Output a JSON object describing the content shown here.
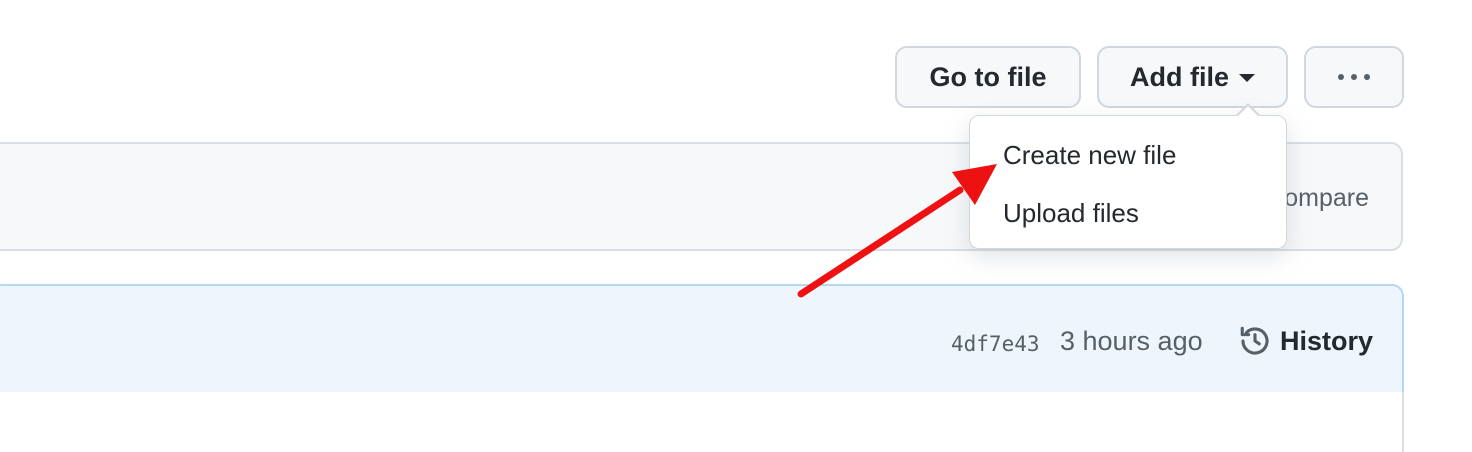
{
  "toolbar": {
    "go_to_file": "Go to file",
    "add_file": "Add file",
    "more_icon": "kebab-horizontal-icon"
  },
  "dropdown": {
    "items": [
      {
        "label": "Create new file"
      },
      {
        "label": "Upload files"
      }
    ]
  },
  "notice": {
    "compare_partial": "ompare"
  },
  "commit": {
    "hash": "4df7e43",
    "time": "3 hours ago",
    "history_label": "History",
    "history_icon": "history-icon"
  },
  "annotation": {
    "arrow_color": "#ee1111",
    "points_to": "Create new file"
  }
}
